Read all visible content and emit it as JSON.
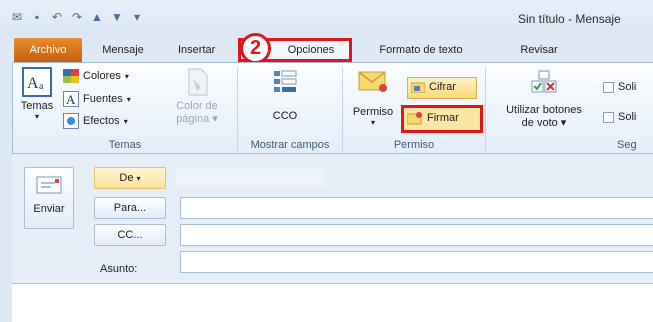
{
  "window": {
    "title": "Sin título  -  Mensaje"
  },
  "quick_access": [
    "outlook-icon",
    "save-icon",
    "undo-icon",
    "redo-icon",
    "up-icon",
    "down-icon",
    "customize-icon"
  ],
  "tabs": {
    "file": "Archivo",
    "message": "Mensaje",
    "insert": "Insertar",
    "options": "Opciones",
    "format": "Formato de texto",
    "review": "Revisar"
  },
  "step_badge": "2",
  "ribbon": {
    "themes_group": {
      "label": "Temas",
      "themes_button": "Temas",
      "colors": "Colores",
      "fonts": "Fuentes",
      "effects": "Efectos",
      "page_color_line1": "Color de",
      "page_color_line2": "página"
    },
    "show_fields_group": {
      "label": "Mostrar campos",
      "bcc": "CCO"
    },
    "permission_group": {
      "label": "Permiso",
      "permission": "Permiso",
      "encrypt": "Cifrar",
      "sign": "Firmar"
    },
    "tracking_group": {
      "label": "Seg",
      "voting_line1": "Utilizar botones",
      "voting_line2": "de voto",
      "request1": "Soli",
      "request2": "Soli"
    }
  },
  "compose": {
    "send": "Enviar",
    "from": "De",
    "to": "Para...",
    "cc": "CC...",
    "subject": "Asunto:"
  },
  "colors": {
    "highlight": "#e0161b",
    "file_tab": "#d9700f",
    "accent_yellow": "#fce6a5"
  }
}
